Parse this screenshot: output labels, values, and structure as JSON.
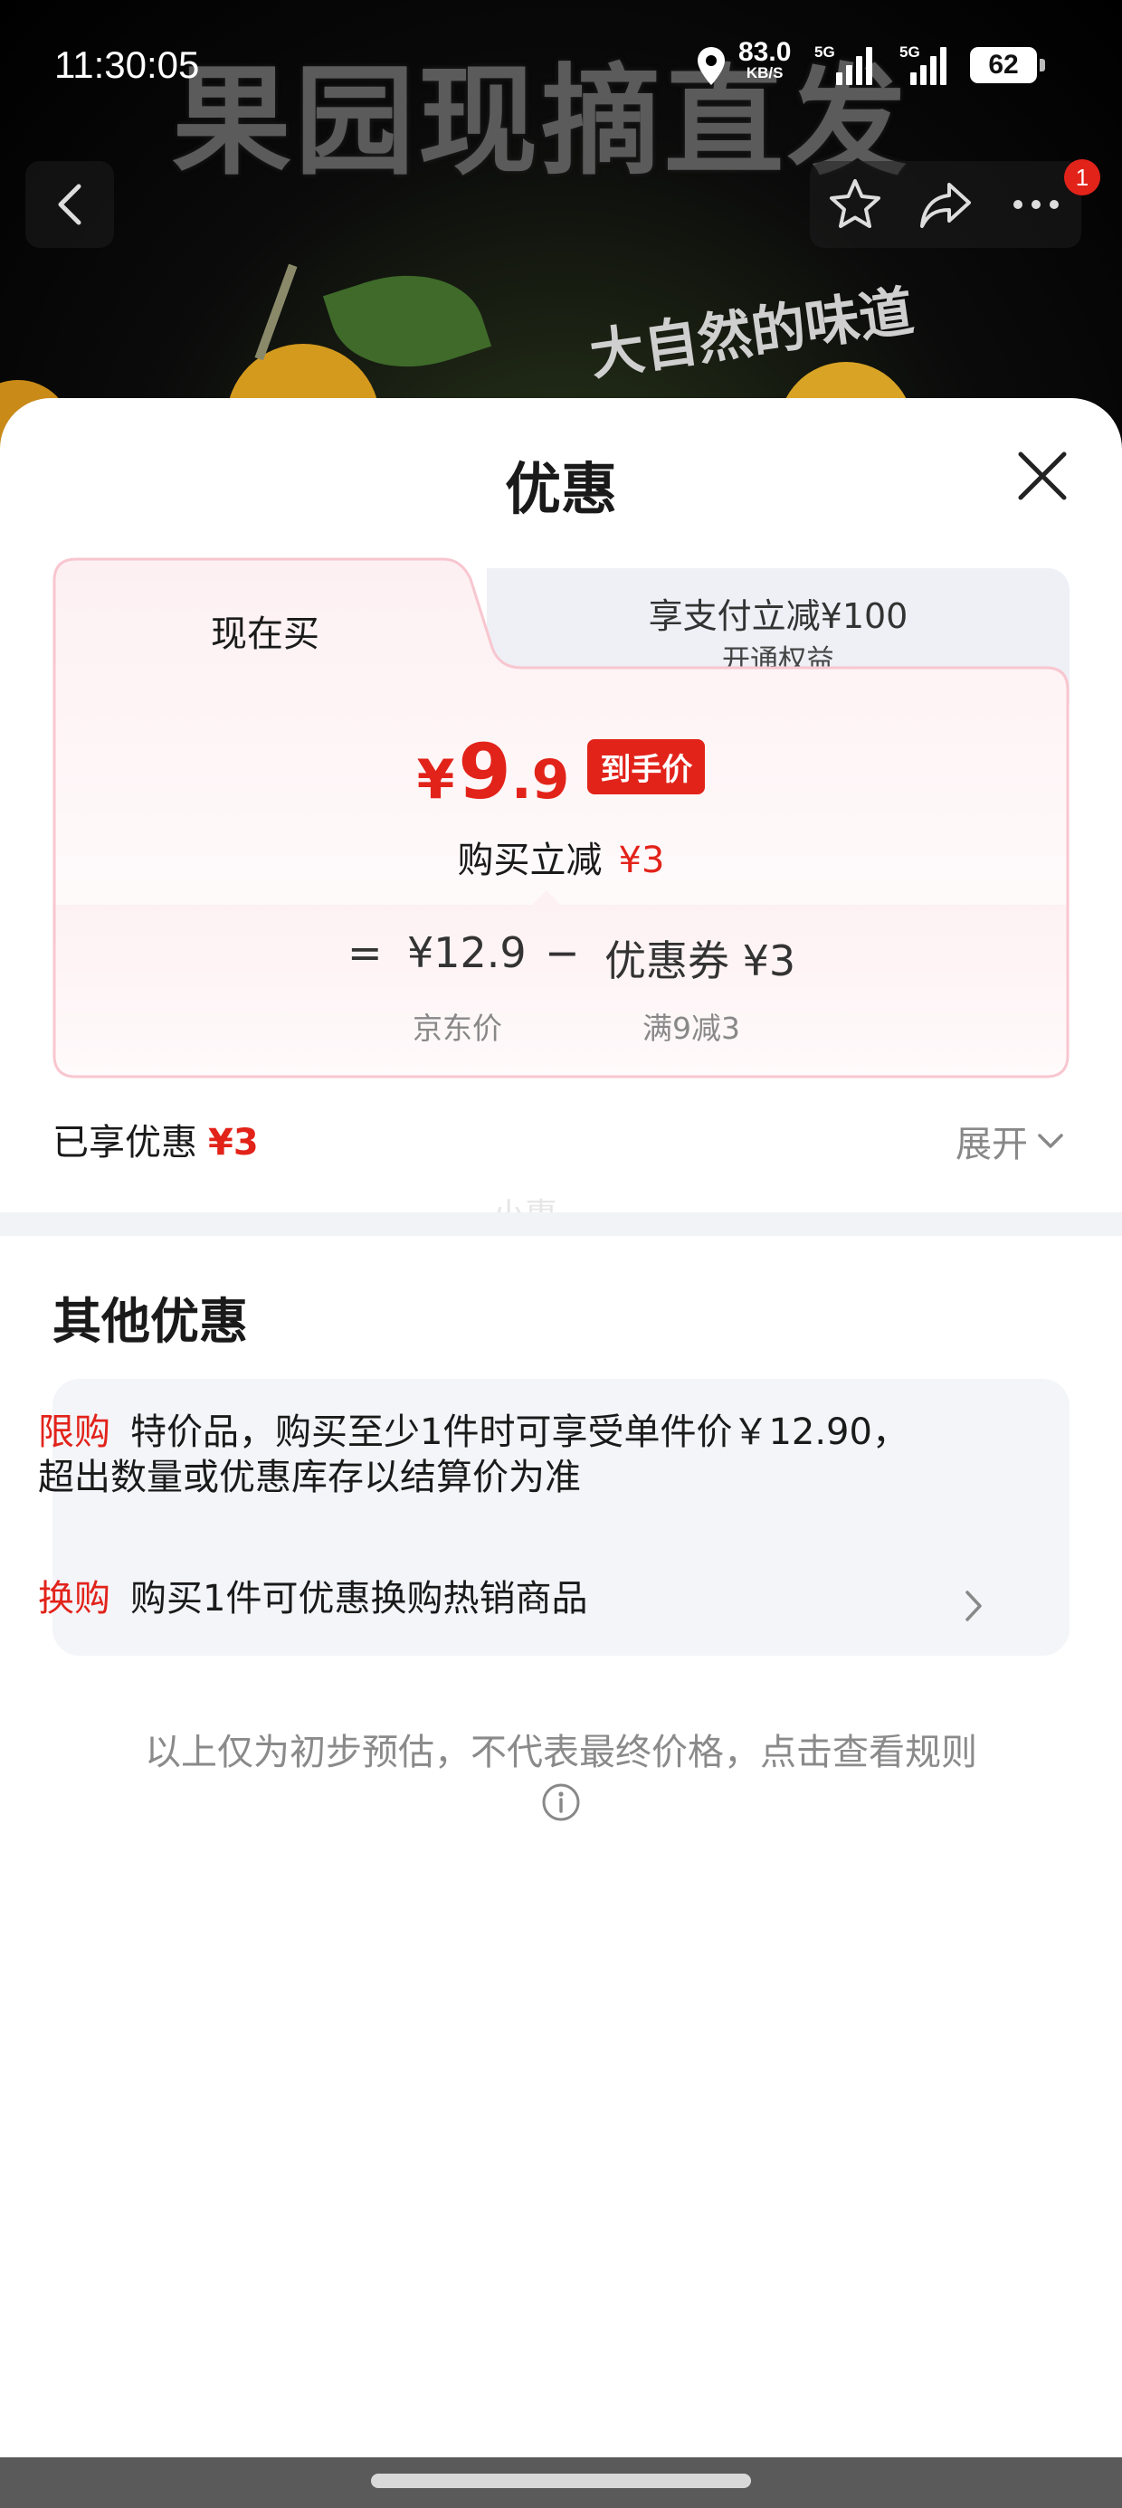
{
  "status_bar": {
    "time": "11:30:05",
    "net_speed_value": "83.0",
    "net_speed_unit": "KB/S",
    "signal_1_label": "5G",
    "signal_2_label": "5G",
    "battery": "62"
  },
  "background": {
    "banner_text": "果园现摘直发",
    "slogan": "大自然的味道",
    "notification_count": "1"
  },
  "sheet": {
    "title": "优惠",
    "tabs": {
      "active_label": "现在买",
      "other_label": "享支付立减¥100",
      "other_sublabel": "开通权益"
    },
    "price": {
      "currency": "¥",
      "integer": "9",
      "decimal": ".9",
      "final_tag": "到手价",
      "discount_label": "购买立减",
      "discount_value": "¥3"
    },
    "calc": {
      "equals": "=",
      "base_price": "¥12.9",
      "minus": "−",
      "coupon": "优惠券 ¥3",
      "base_label": "京东价",
      "coupon_label": "满9减3"
    },
    "enjoyed_label": "已享优惠",
    "enjoyed_value": "¥3",
    "expand_label": "展开",
    "watermark": "小惠"
  },
  "other": {
    "title": "其他优惠",
    "promos": [
      {
        "tag": "限购",
        "line1": "特价品，购买至少1件时可享受单件价￥12.90，",
        "line2": "超出数量或优惠库存以结算价为准"
      },
      {
        "tag": "换购",
        "line1": "购买1件可优惠换购热销商品"
      }
    ]
  },
  "note": "以上仅为初步预估，不代表最终价格，点击查看规则",
  "colors": {
    "accent_red": "#e2231a",
    "tab_inactive_bg": "#eef0f6",
    "card_border": "#f8c6cf"
  }
}
